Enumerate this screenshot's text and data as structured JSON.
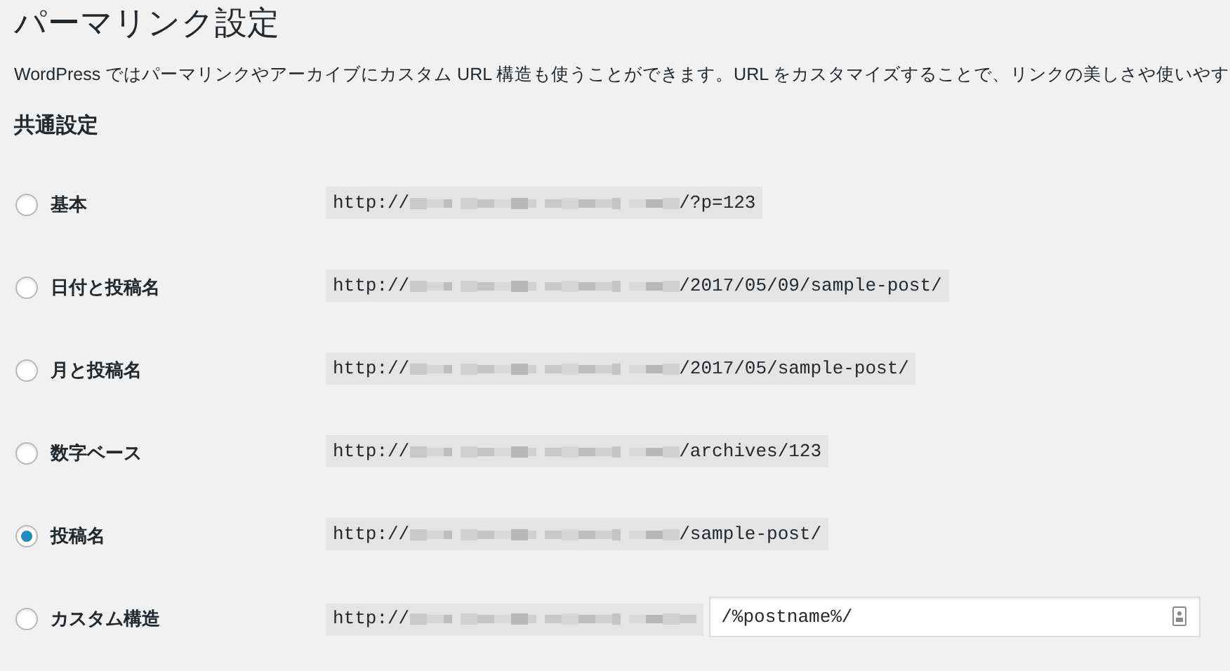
{
  "title": "パーマリンク設定",
  "description": "WordPress ではパーマリンクやアーカイブにカスタム URL 構造も使うことができます。URL をカスタマイズすることで、リンクの美しさや使いやす",
  "section_heading": "共通設定",
  "options": [
    {
      "label": "基本",
      "selected": false,
      "kind": "preset",
      "url_prefix": "http://",
      "url_suffix": "/?p=123"
    },
    {
      "label": "日付と投稿名",
      "selected": false,
      "kind": "preset",
      "url_prefix": "http://",
      "url_suffix": "/2017/05/09/sample-post/"
    },
    {
      "label": "月と投稿名",
      "selected": false,
      "kind": "preset",
      "url_prefix": "http://",
      "url_suffix": "/2017/05/sample-post/"
    },
    {
      "label": "数字ベース",
      "selected": false,
      "kind": "preset",
      "url_prefix": "http://",
      "url_suffix": "/archives/123"
    },
    {
      "label": "投稿名",
      "selected": true,
      "kind": "preset",
      "url_prefix": "http://",
      "url_suffix": "/sample-post/"
    },
    {
      "label": "カスタム構造",
      "selected": false,
      "kind": "custom",
      "url_prefix": "http://",
      "value": "/%postname%/"
    }
  ]
}
